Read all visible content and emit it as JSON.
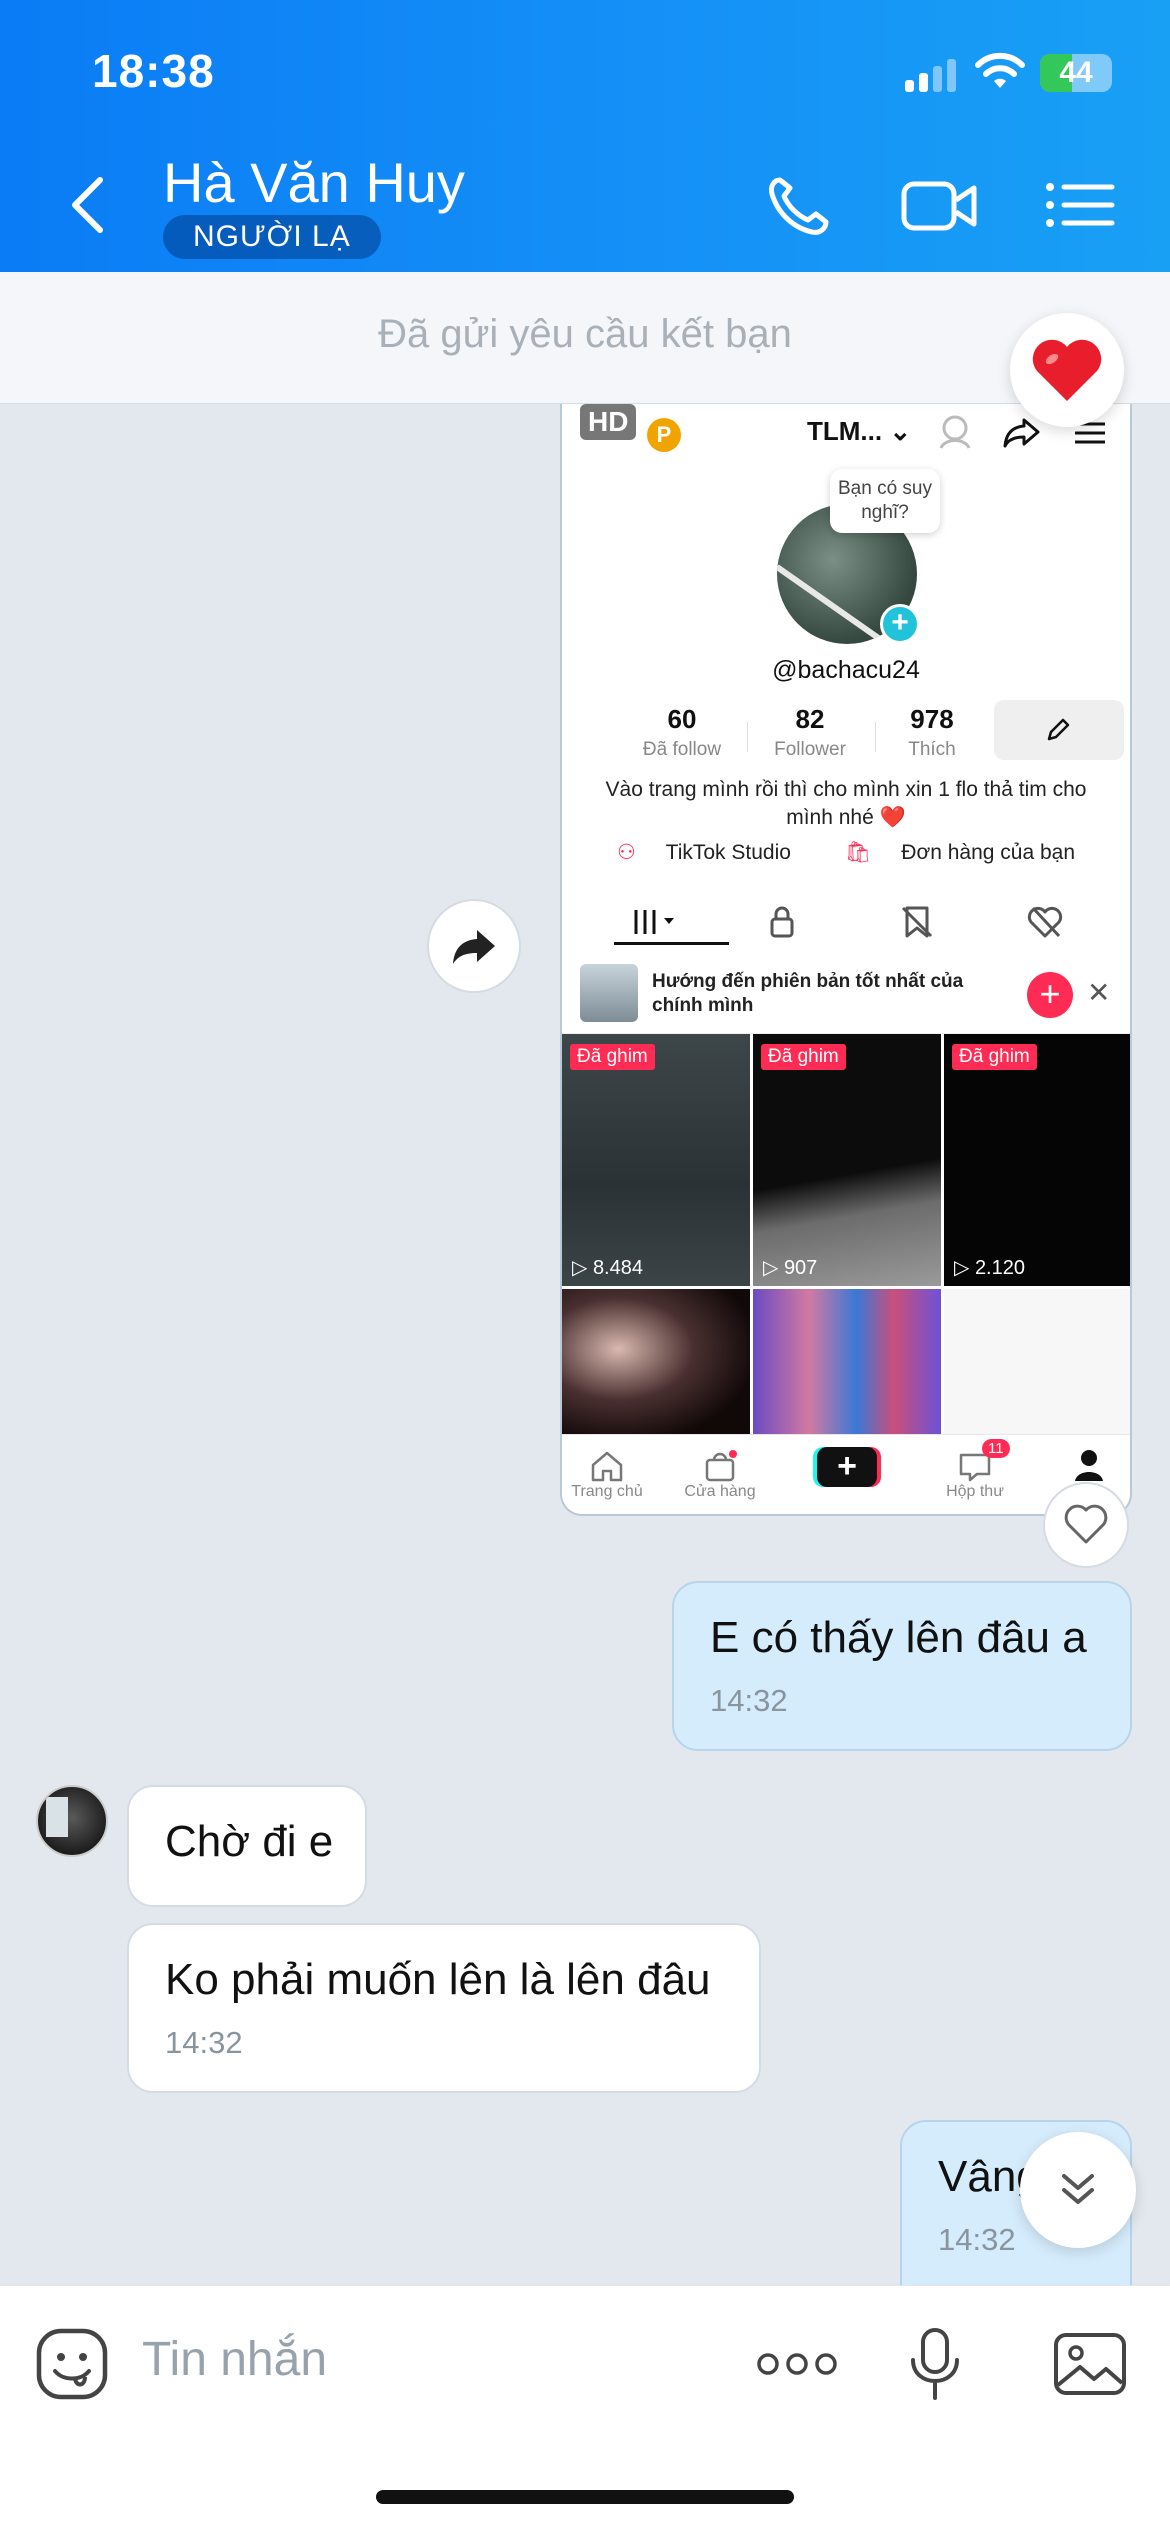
{
  "status_bar": {
    "time": "18:38",
    "battery": "44"
  },
  "header": {
    "contact_name": "Hà Văn Huy",
    "badge": "NGƯỜI LẠ",
    "accent_color": "#0a7cf5"
  },
  "friend_request": {
    "text": "Đã gửi yêu cầu kết bạn"
  },
  "shared_screenshot": {
    "hd_label": "HD",
    "p_label": "P",
    "username_header": "TLM...",
    "thought_bubble": "Bạn có suy nghĩ?",
    "handle": "@bachacu24",
    "stats": [
      {
        "value": "60",
        "label": "Đã follow"
      },
      {
        "value": "82",
        "label": "Follower"
      },
      {
        "value": "978",
        "label": "Thích"
      }
    ],
    "bio": "Vào trang mình rồi thì cho mình xin 1 flo thả tim cho mình nhé ❤️",
    "links": {
      "studio": "TikTok Studio",
      "orders": "Đơn hàng của bạn"
    },
    "promo": {
      "text": "Hướng đến phiên bản tốt nhất của chính mình"
    },
    "videos": [
      {
        "pinned": "Đã ghim",
        "views": "8.484"
      },
      {
        "pinned": "Đã ghim",
        "views": "907"
      },
      {
        "pinned": "Đã ghim",
        "views": "2.120"
      }
    ],
    "nav": {
      "home": "Trang chủ",
      "shop": "Cửa hàng",
      "inbox": "Hộp thư",
      "inbox_count": "11"
    }
  },
  "messages": [
    {
      "direction": "out",
      "text": "E có thấy lên đâu a",
      "time": "14:32"
    },
    {
      "direction": "in",
      "text": "Chờ đi e"
    },
    {
      "direction": "in",
      "text": "Ko phải muốn lên là lên đâu",
      "time": "14:32"
    },
    {
      "direction": "out",
      "text": "Vâng",
      "time": "14:32"
    }
  ],
  "input": {
    "placeholder": "Tin nhắn"
  }
}
